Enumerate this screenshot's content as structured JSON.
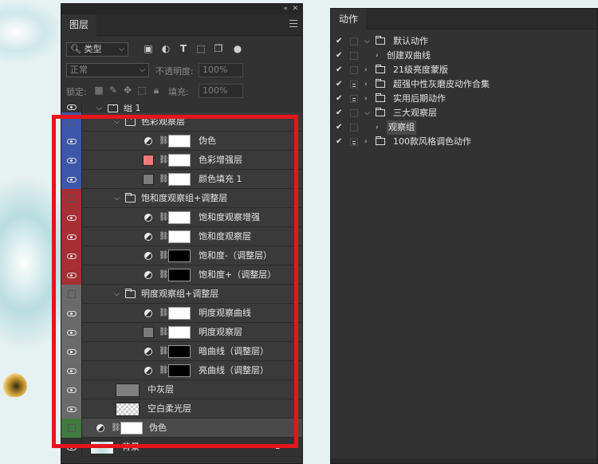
{
  "layers_panel": {
    "tab_label": "图层",
    "filter": {
      "kind_label": "类型"
    },
    "blend": {
      "mode": "正常",
      "opacity_label": "不透明度:",
      "opacity_value": "100%"
    },
    "lock": {
      "label": "锁定:",
      "fill_label": "填充:",
      "fill_value": "100%"
    },
    "rows": [
      {
        "id": "group1",
        "label": "组 1",
        "indent": 0,
        "kind": "group",
        "eye_color": "#323232",
        "visible": true
      },
      {
        "id": "color-group",
        "label": "色彩观察层",
        "indent": 1,
        "kind": "group",
        "eye_color": "#3d57a8",
        "visible": false
      },
      {
        "id": "pseudo-color",
        "label": "伪色",
        "indent": 2,
        "kind": "adjust",
        "mask": "white",
        "eye_color": "#3d57a8",
        "visible": true
      },
      {
        "id": "color-enhance",
        "label": "色彩增强层",
        "indent": 2,
        "kind": "swatch",
        "swatch": "#f07a78",
        "mask": "white",
        "eye_color": "#3d57a8",
        "visible": true
      },
      {
        "id": "color-fill",
        "label": "颜色填充 1",
        "indent": 2,
        "kind": "swatch",
        "swatch": "#7b7b7b",
        "mask": "white",
        "eye_color": "#3d57a8",
        "visible": true
      },
      {
        "id": "saturation-group",
        "label": "饱和度观察组+调整层",
        "indent": 1,
        "kind": "group",
        "eye_color": "#a52f33",
        "visible": false
      },
      {
        "id": "sat-enhance",
        "label": "饱和度观察增强",
        "indent": 2,
        "kind": "adjust",
        "mask": "white",
        "eye_color": "#a52f33",
        "visible": true
      },
      {
        "id": "sat-observe",
        "label": "饱和度观察层",
        "indent": 2,
        "kind": "adjust",
        "mask": "white",
        "eye_color": "#a52f33",
        "visible": true
      },
      {
        "id": "sat-minus",
        "label": "饱和度-（调整层）",
        "indent": 2,
        "kind": "adjust",
        "mask": "black",
        "eye_color": "#a52f33",
        "visible": true
      },
      {
        "id": "sat-plus",
        "label": "饱和度+（调整层）",
        "indent": 2,
        "kind": "adjust",
        "mask": "black",
        "eye_color": "#a52f33",
        "visible": true
      },
      {
        "id": "lum-group",
        "label": "明度观察组+调整层",
        "indent": 1,
        "kind": "group",
        "eye_color": "#6a6a6a",
        "visible": false
      },
      {
        "id": "lum-curve",
        "label": "明度观察曲线",
        "indent": 2,
        "kind": "adjust",
        "mask": "white",
        "eye_color": "#6a6a6a",
        "visible": true
      },
      {
        "id": "lum-layer",
        "label": "明度观察层",
        "indent": 2,
        "kind": "swatch",
        "swatch": "#7b7b7b",
        "mask": "white",
        "eye_color": "#6a6a6a",
        "visible": true
      },
      {
        "id": "dark-curve",
        "label": "暗曲线（调整层）",
        "indent": 2,
        "kind": "adjust",
        "mask": "black",
        "eye_color": "#6a6a6a",
        "visible": true
      },
      {
        "id": "light-curve",
        "label": "亮曲线（调整层）",
        "indent": 2,
        "kind": "adjust",
        "mask": "black",
        "eye_color": "#6a6a6a",
        "visible": true
      },
      {
        "id": "mid-gray",
        "label": "中灰层",
        "indent": 1,
        "kind": "thumb",
        "thumb": "#808080",
        "eye_color": "#6a6a6a",
        "visible": true
      },
      {
        "id": "soft-light",
        "label": "空白柔光层",
        "indent": 1,
        "kind": "thumb-checker",
        "eye_color": "#6a6a6a",
        "visible": true
      },
      {
        "id": "pseudo-color-2",
        "label": "伪色",
        "indent": 0,
        "kind": "adjust-selected",
        "mask": "white",
        "eye_color": "#3f7a3f",
        "visible": false
      },
      {
        "id": "background",
        "label": "背景",
        "indent": 0,
        "kind": "background",
        "eye_color": "#323232",
        "visible": true
      }
    ]
  },
  "actions_panel": {
    "tab_label": "动作",
    "rows": [
      {
        "label": "默认动作",
        "level": 0,
        "folder": true,
        "expanded": true,
        "checked": true,
        "dialog": false
      },
      {
        "label": "创建双曲线",
        "level": 1,
        "folder": false,
        "expanded": false,
        "checked": true,
        "dialog": false
      },
      {
        "label": "21级亮度蒙版",
        "level": 0,
        "folder": true,
        "expanded": false,
        "checked": true,
        "dialog": false
      },
      {
        "label": "超强中性灰磨皮动作合集",
        "level": 0,
        "folder": true,
        "expanded": false,
        "checked": true,
        "dialog": true
      },
      {
        "label": "实用后期动作",
        "level": 0,
        "folder": true,
        "expanded": false,
        "checked": true,
        "dialog": true
      },
      {
        "label": "三大观察层",
        "level": 0,
        "folder": true,
        "expanded": true,
        "checked": true,
        "dialog": false
      },
      {
        "label": "观察组",
        "level": 1,
        "folder": false,
        "expanded": false,
        "checked": true,
        "dialog": false,
        "selected": true
      },
      {
        "label": "100款风格调色动作",
        "level": 0,
        "folder": true,
        "expanded": false,
        "checked": true,
        "dialog": true
      }
    ]
  }
}
